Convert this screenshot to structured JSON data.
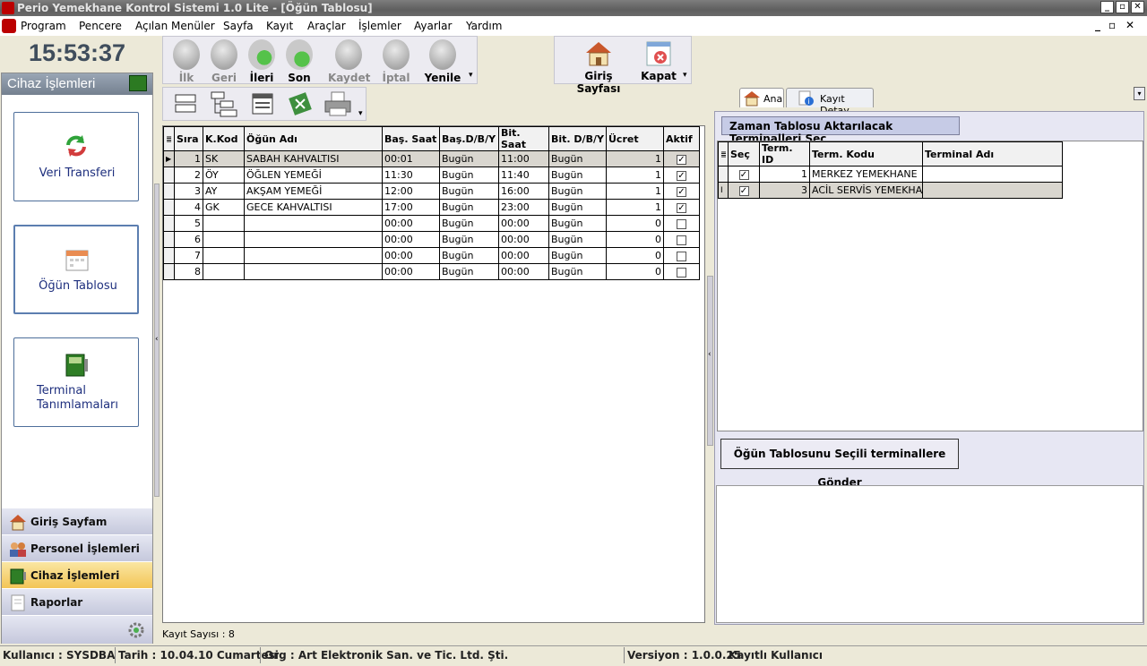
{
  "window": {
    "title": "Perio Yemekhane Kontrol Sistemi 1.0 Lite - [Öğün Tablosu]",
    "minimize": "_",
    "restore": "▫",
    "close": "✕"
  },
  "menu": {
    "items": [
      "Program",
      "Pencere",
      "Açılan Menüler",
      "Sayfa",
      "Kayıt",
      "Araçlar",
      "İşlemler",
      "Ayarlar",
      "Yardım"
    ]
  },
  "clock": "15:53:37",
  "left_panel": {
    "header": "Cihaz İşlemleri",
    "big_buttons": [
      {
        "label": "Veri Transferi"
      },
      {
        "label": "Öğün Tablosu"
      },
      {
        "label_line1": "Terminal",
        "label_line2": "Tanımlamaları"
      }
    ],
    "nav": [
      "Giriş Sayfam",
      "Personel İşlemleri",
      "Cihaz İşlemleri",
      "Raporlar"
    ]
  },
  "toolbar": {
    "first": "İlk",
    "prev": "Geri",
    "next": "İleri",
    "last": "Son",
    "save": "Kaydet",
    "cancel": "İptal",
    "refresh": "Yenile",
    "home": "Giriş Sayfası",
    "close": "Kapat"
  },
  "grid": {
    "headers": [
      "Sıra",
      "K.Kod",
      "Öğün Adı",
      "Baş. Saat",
      "Baş.D/B/Y",
      "Bit. Saat",
      "Bit. D/B/Y",
      "Ücret",
      "Aktif"
    ],
    "rows": [
      {
        "sira": "1",
        "kod": "SK",
        "ad": "SABAH KAHVALTISI",
        "bas": "00:01",
        "basd": "Bugün",
        "bit": "11:00",
        "bitd": "Bugün",
        "ucret": "1",
        "aktif": true
      },
      {
        "sira": "2",
        "kod": "ÖY",
        "ad": "ÖĞLEN YEMEĞİ",
        "bas": "11:30",
        "basd": "Bugün",
        "bit": "11:40",
        "bitd": "Bugün",
        "ucret": "1",
        "aktif": true
      },
      {
        "sira": "3",
        "kod": "AY",
        "ad": "AKŞAM YEMEĞİ",
        "bas": "12:00",
        "basd": "Bugün",
        "bit": "16:00",
        "bitd": "Bugün",
        "ucret": "1",
        "aktif": true
      },
      {
        "sira": "4",
        "kod": "GK",
        "ad": "GECE KAHVALTISI",
        "bas": "17:00",
        "basd": "Bugün",
        "bit": "23:00",
        "bitd": "Bugün",
        "ucret": "1",
        "aktif": true
      },
      {
        "sira": "5",
        "kod": "",
        "ad": "",
        "bas": "00:00",
        "basd": "Bugün",
        "bit": "00:00",
        "bitd": "Bugün",
        "ucret": "0",
        "aktif": false
      },
      {
        "sira": "6",
        "kod": "",
        "ad": "",
        "bas": "00:00",
        "basd": "Bugün",
        "bit": "00:00",
        "bitd": "Bugün",
        "ucret": "0",
        "aktif": false
      },
      {
        "sira": "7",
        "kod": "",
        "ad": "",
        "bas": "00:00",
        "basd": "Bugün",
        "bit": "00:00",
        "bitd": "Bugün",
        "ucret": "0",
        "aktif": false
      },
      {
        "sira": "8",
        "kod": "",
        "ad": "",
        "bas": "00:00",
        "basd": "Bugün",
        "bit": "00:00",
        "bitd": "Bugün",
        "ucret": "0",
        "aktif": false
      }
    ],
    "record_count": "Kayıt Sayısı : 8"
  },
  "right": {
    "tabs": [
      "Ana",
      "Kayıt Detay"
    ],
    "section_title": "Zaman Tablosu Aktarılacak Terminalleri Seç",
    "headers": [
      "Seç",
      "Term. ID",
      "Term. Kodu",
      "Terminal Adı"
    ],
    "rows": [
      {
        "sec": true,
        "id": "1",
        "kod": "MERKEZ YEMEKHANE",
        "ad": ""
      },
      {
        "sec": true,
        "id": "3",
        "kod": "ACİL SERVİS YEMEKHANE",
        "ad": ""
      }
    ],
    "send_button": "Öğün Tablosunu Seçili terminallere Gönder"
  },
  "status": {
    "user": "Kullanıcı : SYSDBA",
    "date": "Tarih : 10.04.10 Cumartesi",
    "org": "Org : Art Elektronik San. ve Tic. Ltd. Şti.",
    "version": "Versiyon : 1.0.0.25",
    "license": "Kayıtlı Kullanıcı"
  }
}
